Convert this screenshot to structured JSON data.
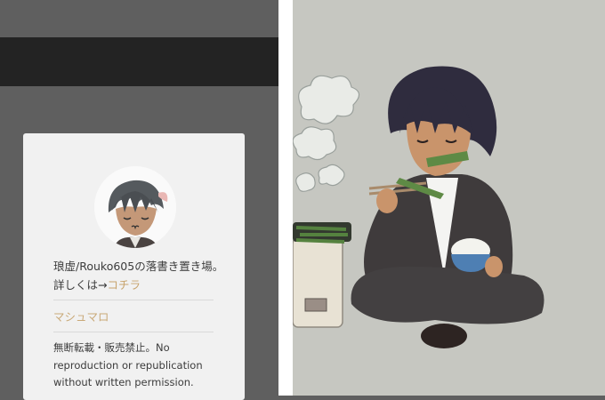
{
  "profile": {
    "bio_text": "琅虚/Rouko605の落書き置き場。詳しくは→",
    "bio_link": "コチラ",
    "marshmallow_link": "マシュマロ",
    "notice_line1": "無断転載・販売禁止。No",
    "notice_line2": "reproduction or republication",
    "notice_line3": "without written permission."
  },
  "colors": {
    "link": "#c8a46d",
    "panel_bg": "#5f5f5f",
    "topbar_bg": "#232323",
    "card_bg": "#f1f1f1",
    "art_bg": "#c6c7c1"
  }
}
